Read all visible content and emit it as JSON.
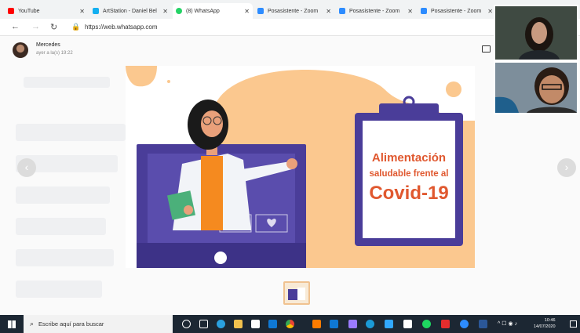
{
  "tabs": [
    {
      "label": "YouTube",
      "fav_color": "#ff0000"
    },
    {
      "label": "ArtStation - Daniel Bel",
      "fav_color": "#13aff0"
    },
    {
      "label": "(8) WhatsApp",
      "fav_color": "#25d366"
    },
    {
      "label": "Posasistente - Zoom",
      "fav_color": "#2d8cff"
    },
    {
      "label": "Posasistente - Zoom",
      "fav_color": "#2d8cff"
    },
    {
      "label": "Posasistente - Zoom",
      "fav_color": "#2d8cff"
    }
  ],
  "address": {
    "url": "https://web.whatsapp.com"
  },
  "viewer": {
    "sender": "Mercedes",
    "timestamp": "ayer a la(s) 19:22"
  },
  "slide": {
    "title_line1": "Alimentación",
    "title_line2": "saludable frente al",
    "title_line3": "Covid-19",
    "accent": "#e0582f",
    "board": "#4a3d99",
    "blob": "#fbc88f"
  },
  "taskbar": {
    "search_placeholder": "Escribe aquí para buscar",
    "time": "10:46",
    "date": "14/07/2020"
  }
}
